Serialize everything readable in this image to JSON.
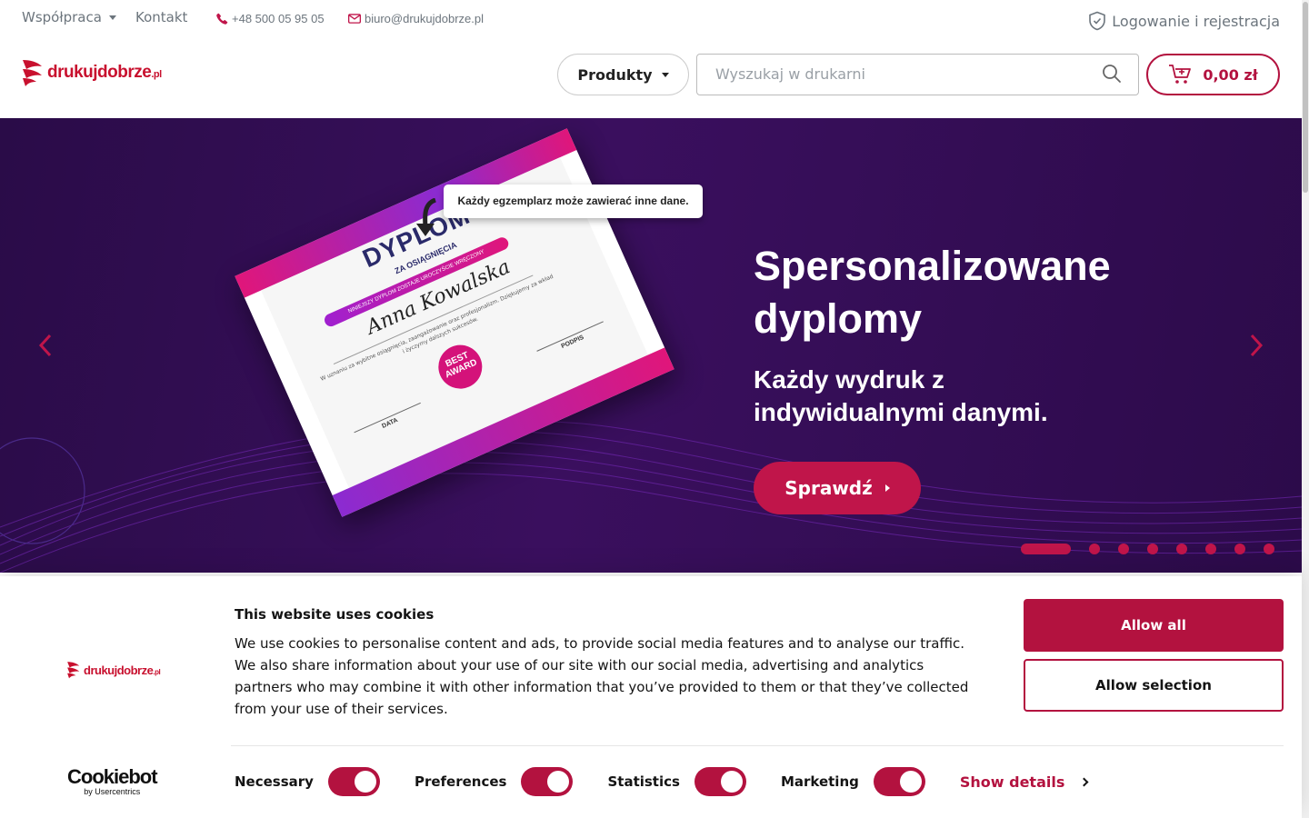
{
  "topbar": {
    "cooperation": "Współpraca",
    "contact": "Kontakt",
    "phone": "+48 500 05 95 05",
    "email": "biuro@drukujdobrze.pl",
    "login": "Logowanie i rejestracja"
  },
  "header": {
    "logo_main": "drukujdobrze",
    "logo_tld": ".pl",
    "products_label": "Produkty",
    "search_placeholder": "Wyszukaj w drukarni",
    "cart_total": "0,00 zł"
  },
  "hero": {
    "tooltip": "Każdy egzemplarz może zawierać inne dane.",
    "diploma_title": "DYPLOM",
    "diploma_subtitle": "ZA OSIĄGNIĘCIA",
    "diploma_ribbon": "NINIEJSZY DYPLOM ZOSTAJE UROCZYŚCIE WRĘCZONY",
    "diploma_signature": "Anna Kowalska",
    "diploma_text": "W uznaniu za wybitne osiągnięcia, zaangażowanie oraz profesjonalizm. Dziękujemy za wkład i życzymy dalszych sukcesów.",
    "diploma_badge": "BEST AWARD",
    "diploma_sign_label": "PODPIS",
    "diploma_date_label": "DATA",
    "title": "Spersonalizowane dyplomy",
    "subtitle": "Każdy wydruk z indywidualnymi danymi.",
    "cta": "Sprawdź",
    "slide_count": 8,
    "active_slide": 1
  },
  "cookie": {
    "logo_main": "drukujdobrze",
    "logo_tld": ".pl",
    "title": "This website uses cookies",
    "text": "We use cookies to personalise content and ads, to provide social media features and to analyse our traffic. We also share information about your use of our site with our social media, advertising and analytics partners who may combine it with other information that you’ve provided to them or that they’ve collected from your use of their services.",
    "allow_all": "Allow all",
    "allow_selection": "Allow selection",
    "cookiebot": "Cookiebot",
    "cookiebot_by": "by Usercentrics",
    "toggles": [
      {
        "label": "Necessary",
        "on": true
      },
      {
        "label": "Preferences",
        "on": true
      },
      {
        "label": "Statistics",
        "on": true
      },
      {
        "label": "Marketing",
        "on": true
      }
    ],
    "show_details": "Show details"
  },
  "colors": {
    "brand": "#b3123f",
    "hero_bg": "#2a0c48"
  }
}
